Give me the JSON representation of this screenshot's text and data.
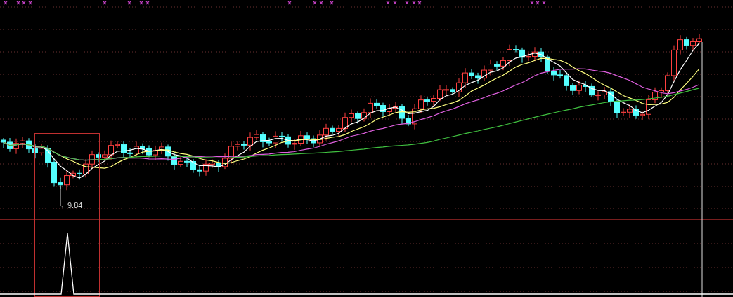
{
  "chart": {
    "low_label": "←9.84"
  }
}
